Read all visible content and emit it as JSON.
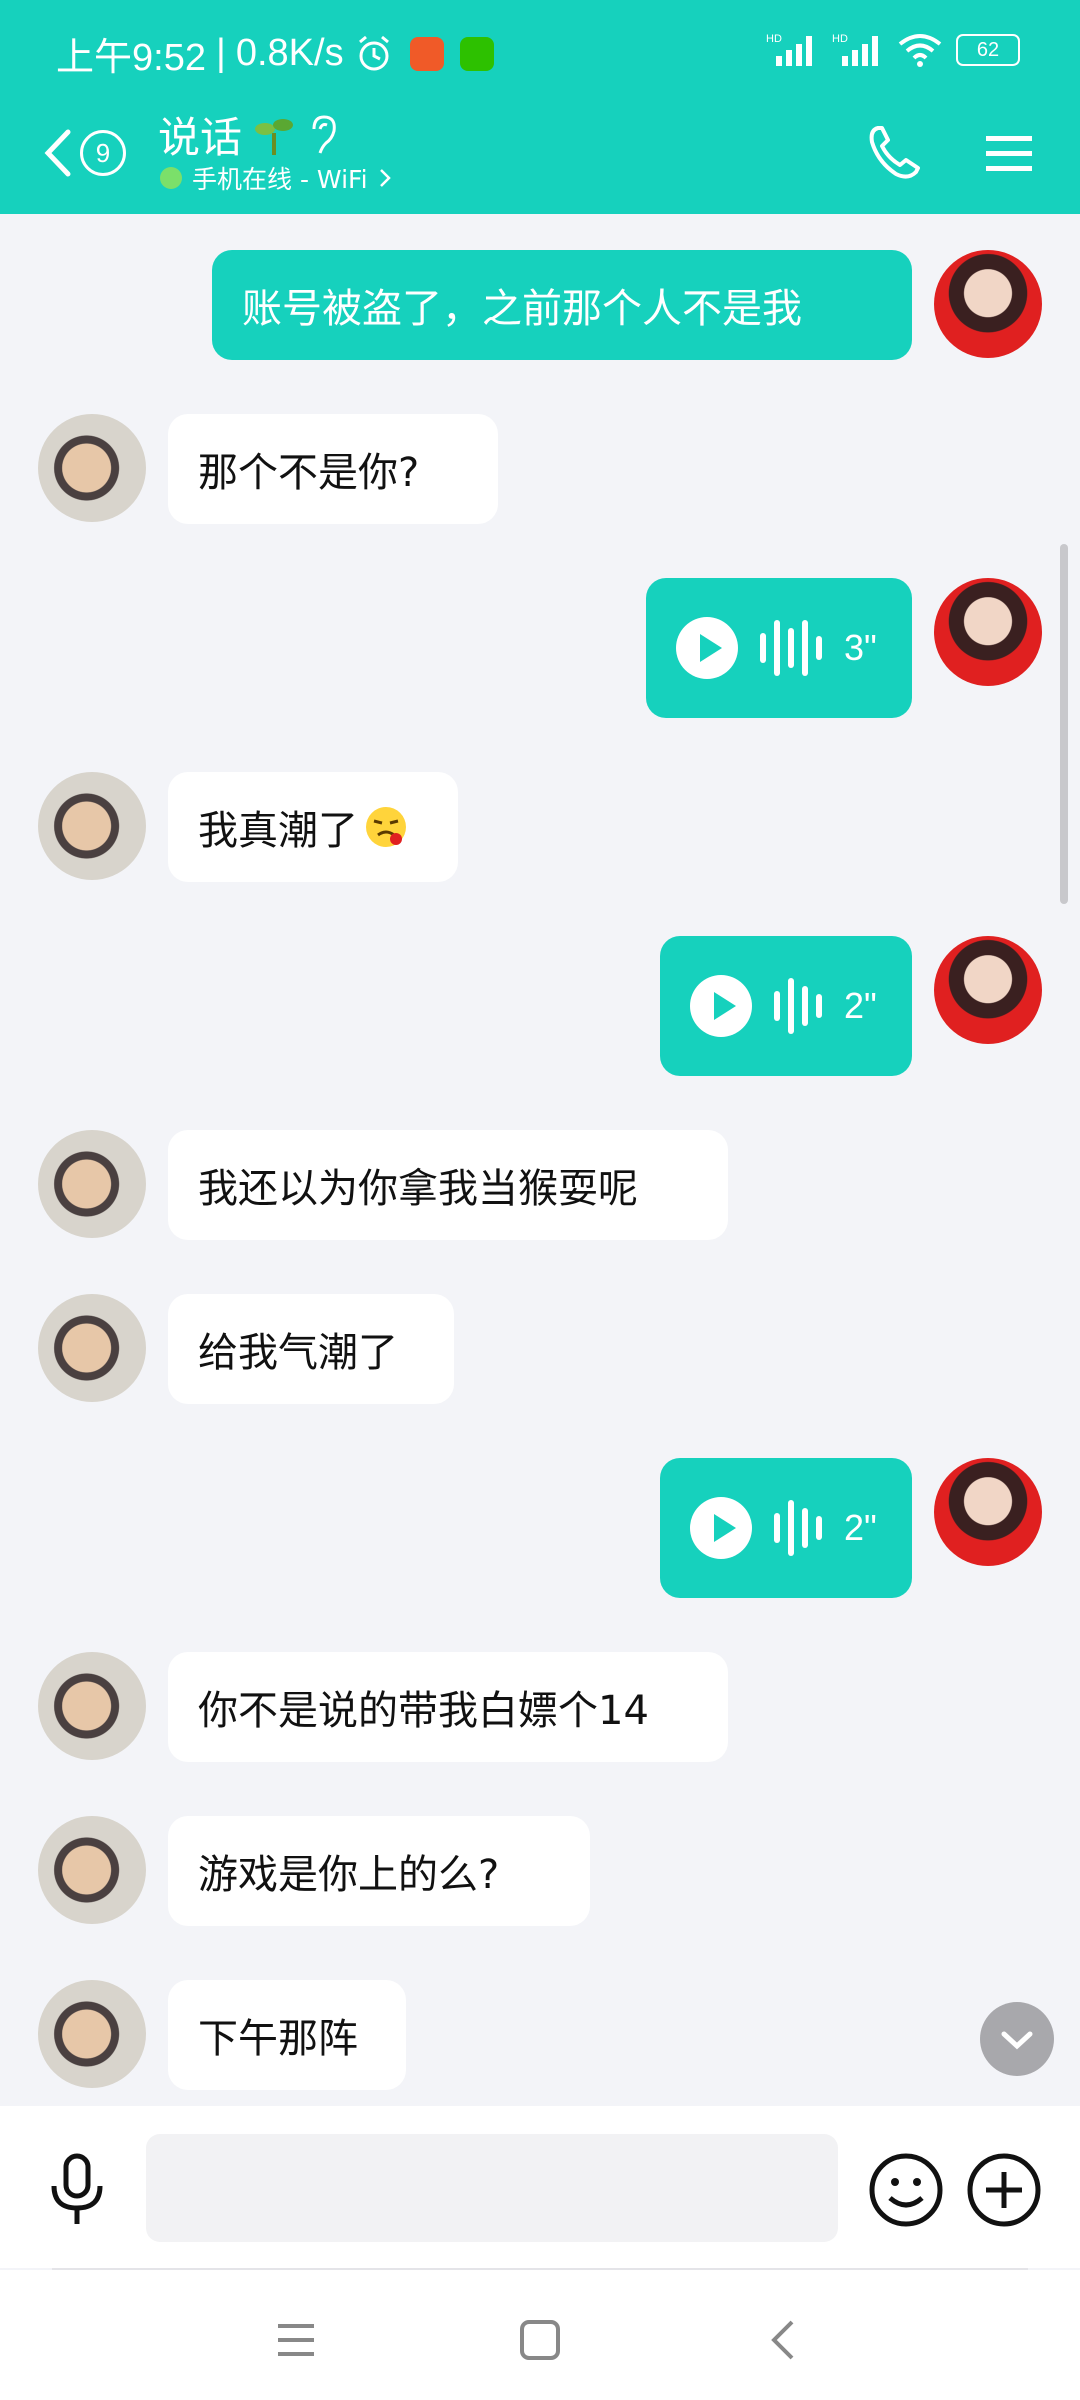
{
  "status_bar": {
    "time": "上午9:52",
    "separator": "|",
    "net_speed": "0.8K/s",
    "network_1": "HD",
    "network_2": "HD",
    "battery": "62"
  },
  "header": {
    "unread_count": "9",
    "contact_name": "说话",
    "presence": "手机在线 - WiFi",
    "accent_color": "#16d1bd"
  },
  "messages": [
    {
      "side": "out",
      "type": "text",
      "text": "账号被盗了，之前那个人不是我"
    },
    {
      "side": "in",
      "type": "text",
      "text": "那个不是你?"
    },
    {
      "side": "out",
      "type": "voice",
      "duration": "3\""
    },
    {
      "side": "in",
      "type": "text",
      "text": "我真潮了",
      "emoji": "sick-face"
    },
    {
      "side": "out",
      "type": "voice",
      "duration": "2\""
    },
    {
      "side": "in",
      "type": "text",
      "text": "我还以为你拿我当猴耍呢"
    },
    {
      "side": "in",
      "type": "text",
      "text": "给我气潮了"
    },
    {
      "side": "out",
      "type": "voice",
      "duration": "2\""
    },
    {
      "side": "in",
      "type": "text",
      "text": "你不是说的带我白嫖个14"
    },
    {
      "side": "in",
      "type": "text",
      "text": "游戏是你上的么?"
    },
    {
      "side": "in",
      "type": "text",
      "text": "下午那阵"
    }
  ],
  "input": {
    "value": "",
    "placeholder": ""
  },
  "icons": {
    "back": "chevron-left-icon",
    "call": "phone-icon",
    "menu": "menu-icon",
    "mic": "microphone-icon",
    "emoji": "smiley-icon",
    "plus": "plus-circle-icon",
    "scroll_down": "chevron-down-icon"
  }
}
